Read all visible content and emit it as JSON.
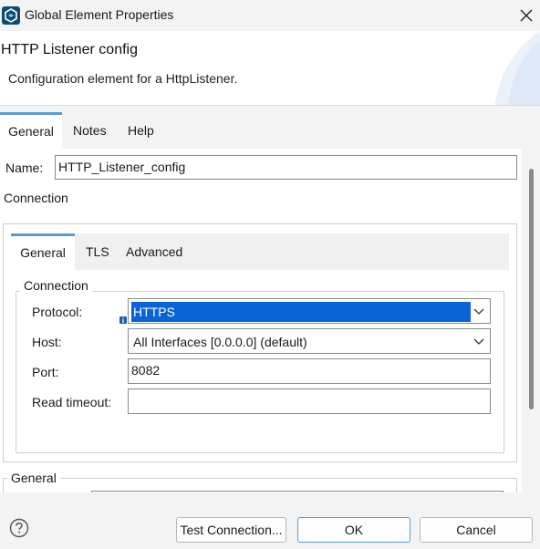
{
  "window": {
    "title": "Global Element Properties",
    "icon": "mule-app-icon",
    "close_icon": "close-icon"
  },
  "header": {
    "title": "HTTP Listener config",
    "description": "Configuration element for a HttpListener."
  },
  "outer_tabs": [
    {
      "label": "General",
      "active": true
    },
    {
      "label": "Notes",
      "active": false
    },
    {
      "label": "Help",
      "active": false
    }
  ],
  "general": {
    "name_label": "Name:",
    "name_value": "HTTP_Listener_config",
    "connection_label": "Connection"
  },
  "inner_tabs": [
    {
      "label": "General",
      "active": true
    },
    {
      "label": "TLS",
      "active": false
    },
    {
      "label": "Advanced",
      "active": false
    }
  ],
  "connection_group": {
    "title": "Connection",
    "protocol_label": "Protocol:",
    "protocol_value": "HTTPS",
    "host_label": "Host:",
    "host_value": "All Interfaces [0.0.0.0] (default)",
    "port_label": "Port:",
    "port_value": "8082",
    "read_timeout_label": "Read timeout:",
    "read_timeout_value": ""
  },
  "general_group": {
    "title": "General"
  },
  "footer": {
    "test_connection_label": "Test Connection...",
    "ok_label": "OK",
    "cancel_label": "Cancel"
  },
  "colors": {
    "accent": "#5a9bd5",
    "selection": "#0a64d6"
  }
}
